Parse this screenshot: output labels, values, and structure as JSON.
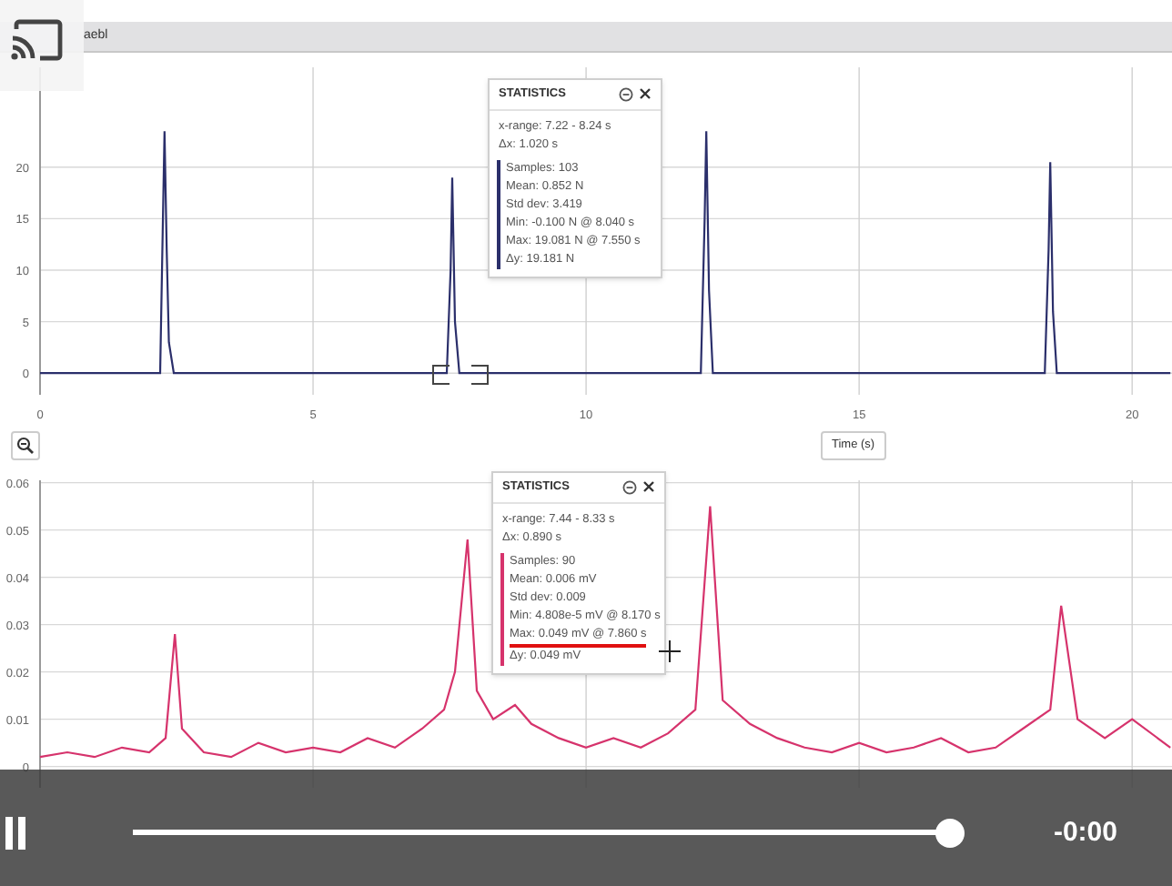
{
  "header": {
    "title": "aebl"
  },
  "charts": [
    {
      "chart_data": {
        "type": "line",
        "xlabel": "Time (s)",
        "x": [
          0,
          2.2,
          2.28,
          2.32,
          2.36,
          2.45,
          7.45,
          7.52,
          7.55,
          7.6,
          7.68,
          12.1,
          12.17,
          12.2,
          12.25,
          12.32,
          18.4,
          18.47,
          18.5,
          18.55,
          18.62,
          20.7
        ],
        "series": [
          {
            "color": "#2b2f6b",
            "values": [
              0,
              0,
              23.5,
              12,
              3,
              0,
              0,
              10,
              19,
              5,
              0,
              0,
              15,
              23.5,
              8,
              0,
              0,
              12,
              20.5,
              6,
              0,
              0
            ]
          }
        ],
        "xlim": [
          0,
          20.73
        ],
        "ylim": [
          -2.1,
          29.7
        ],
        "xticks": [
          0,
          5,
          10,
          15,
          20
        ],
        "yticks": [
          0,
          5,
          10,
          15,
          20
        ],
        "grid": true
      },
      "selection": true,
      "statistics": {
        "title": "STATISTICS",
        "color": "#2b2f6b",
        "range": [
          "x-range: 7.22 - 8.24 s",
          "Δx: 1.020 s"
        ],
        "values": [
          {
            "text": "Samples: 103",
            "underlined": false
          },
          {
            "text": "Mean: 0.852 N",
            "underlined": false
          },
          {
            "text": "Std dev: 3.419",
            "underlined": false
          },
          {
            "text": "Min: -0.100 N @ 8.040 s",
            "underlined": false
          },
          {
            "text": "Max: 19.081 N @ 7.550 s",
            "underlined": false
          },
          {
            "text": "Δy: 19.181 N",
            "underlined": false
          }
        ]
      }
    },
    {
      "chart_data": {
        "type": "line",
        "x": [
          0,
          0.5,
          1,
          1.5,
          2,
          2.3,
          2.47,
          2.6,
          3,
          3.5,
          4,
          4.5,
          5,
          5.5,
          6,
          6.5,
          7,
          7.4,
          7.6,
          7.83,
          8,
          8.3,
          8.7,
          9,
          9.5,
          10,
          10.5,
          11,
          11.5,
          12,
          12.27,
          12.5,
          13,
          13.5,
          14,
          14.5,
          15,
          15.5,
          16,
          16.5,
          17,
          17.5,
          18,
          18.5,
          18.7,
          19,
          19.5,
          20,
          20.7
        ],
        "series": [
          {
            "color": "#d6336c",
            "values": [
              0.002,
              0.003,
              0.002,
              0.004,
              0.003,
              0.006,
              0.028,
              0.008,
              0.003,
              0.002,
              0.005,
              0.003,
              0.004,
              0.003,
              0.006,
              0.004,
              0.008,
              0.012,
              0.02,
              0.048,
              0.016,
              0.01,
              0.013,
              0.009,
              0.006,
              0.004,
              0.006,
              0.004,
              0.007,
              0.012,
              0.055,
              0.014,
              0.009,
              0.006,
              0.004,
              0.003,
              0.005,
              0.003,
              0.004,
              0.006,
              0.003,
              0.004,
              0.008,
              0.012,
              0.034,
              0.01,
              0.006,
              0.01,
              0.004
            ]
          }
        ],
        "xlim": [
          0,
          20.73
        ],
        "ylim": [
          -0.0045,
          0.0605
        ],
        "yticks": [
          0,
          0.01,
          0.02,
          0.03,
          0.04,
          0.05,
          0.06
        ],
        "grid": true
      },
      "statistics": {
        "title": "STATISTICS",
        "color": "#d6336c",
        "range": [
          "x-range: 7.44 - 8.33 s",
          "Δx: 0.890 s"
        ],
        "values": [
          {
            "text": "Samples: 90",
            "underlined": false
          },
          {
            "text": "Mean: 0.006 mV",
            "underlined": false
          },
          {
            "text": "Std dev: 0.009",
            "underlined": false
          },
          {
            "text": "Min: 4.808e-5 mV @ 8.170 s",
            "underlined": false
          },
          {
            "text": "Max: 0.049 mV @ 7.860 s",
            "underlined": true
          },
          {
            "text": "Δy: 0.049 mV",
            "underlined": false
          }
        ]
      }
    }
  ],
  "player": {
    "playing": true,
    "level": 1,
    "time": "-0:00"
  }
}
